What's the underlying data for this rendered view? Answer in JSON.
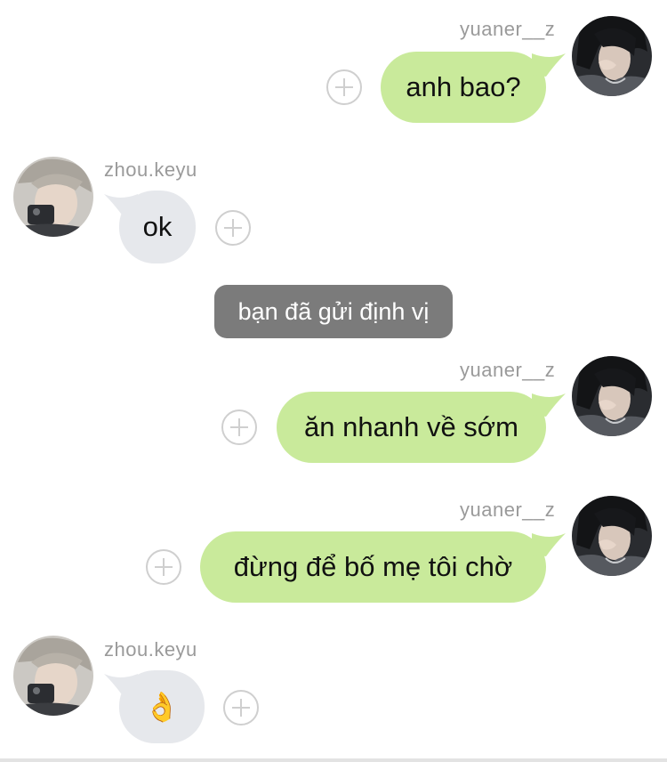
{
  "users": {
    "me": "yuaner__z",
    "other": "zhou.keyu"
  },
  "messages": [
    {
      "sender": "yuaner__z",
      "text": "anh bao?"
    },
    {
      "sender": "zhou.keyu",
      "text": "ok"
    },
    {
      "system": "bạn đã gửi định vị"
    },
    {
      "sender": "yuaner__z",
      "text": "ăn nhanh về sớm"
    },
    {
      "sender": "yuaner__z",
      "text": "đừng để bố mẹ tôi chờ"
    },
    {
      "sender": "zhou.keyu",
      "text": "👌"
    }
  ],
  "colors": {
    "outgoing_bubble": "#c9ea9b",
    "incoming_bubble": "#e6e8ec",
    "system_pill": "#7b7b7b",
    "username": "#9a9a9a"
  },
  "icons": {
    "react_button": "plus-circle-icon"
  }
}
